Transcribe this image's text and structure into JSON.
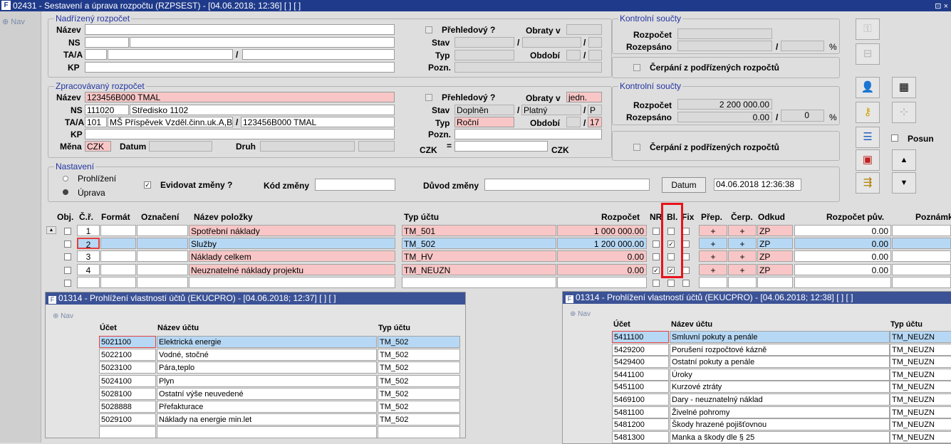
{
  "window": {
    "title": "02431 - Sestavení a úprava rozpočtu (RZPSEST) - [04.06.2018; 12:36] [ ] [ ]",
    "nav": "Nav",
    "window_btn": "⊡ ×"
  },
  "nadrizeny": {
    "legend": "Nadřízený rozpočet",
    "nazev_lbl": "Název",
    "ns_lbl": "NS",
    "taa_lbl": "TA/A",
    "kp_lbl": "KP",
    "prehledovy_lbl": "Přehledový ?",
    "obraty_lbl": "Obraty v",
    "stav_lbl": "Stav",
    "typ_lbl": "Typ",
    "obdobi_lbl": "Období",
    "pozn_lbl": "Pozn.",
    "slash": "/"
  },
  "kontrolni1": {
    "legend": "Kontrolní součty",
    "rozpocet_lbl": "Rozpočet",
    "rozepsano_lbl": "Rozepsáno",
    "pct": "%",
    "slash": "/",
    "cerpani_lbl": "Čerpání z podřízených rozpočtů"
  },
  "zpracovavany": {
    "legend": "Zpracovávaný rozpočet",
    "nazev_lbl": "Název",
    "nazev": "123456B000 TMAL",
    "ns_lbl": "NS",
    "ns_code": "111020",
    "ns_name": "Středisko 1102",
    "taa_lbl": "TA/A",
    "taa_code": "101",
    "taa_name": "MŠ Příspěvek Vzděl.činn.uk.A,B",
    "taa_slash": "/",
    "taa_value": "123456B000 TMAL",
    "kp_lbl": "KP",
    "mena_lbl": "Měna",
    "mena": "CZK",
    "datum_lbl": "Datum",
    "druh_lbl": "Druh",
    "prehledovy_lbl": "Přehledový ?",
    "obraty_lbl": "Obraty v",
    "obraty": "jedn.",
    "stav_lbl": "Stav",
    "stav": "Doplněn",
    "stav_slash": "/",
    "stav2": "Platný",
    "stav_slash2": "/",
    "stav3": "P",
    "typ_lbl": "Typ",
    "typ": "Roční",
    "obdobi_lbl": "Období",
    "obdobi_slash": "/",
    "obdobi": "17",
    "pozn_lbl": "Pozn.",
    "czk1": "CZK",
    "eq": "=",
    "czk2": "CZK"
  },
  "kontrolni2": {
    "legend": "Kontrolní součty",
    "rozpocet_lbl": "Rozpočet",
    "rozpocet": "2 200 000.00",
    "rozepsano_lbl": "Rozepsáno",
    "rozepsano": "0.00",
    "slash": "/",
    "pct_val": "0",
    "pct": "%",
    "cerpani_lbl": "Čerpání z podřízených rozpočtů"
  },
  "nastaveni": {
    "legend": "Nastavení",
    "prohlizeni": "Prohlížení",
    "uprava": "Úprava",
    "evidovat": "Evidovat změny ?",
    "kod_lbl": "Kód změny",
    "duvod_lbl": "Důvod změny",
    "datum_btn": "Datum",
    "datum_value": "04.06.2018 12:36:38"
  },
  "toolbar": {
    "posun": "Posun",
    "up": "▲",
    "down": "▼"
  },
  "grid": {
    "headers": {
      "obj": "Obj.",
      "cr": "Č.ř.",
      "format": "Formát",
      "oznaceni": "Označení",
      "nazev": "Název položky",
      "typ": "Typ účtu",
      "rozpocet": "Rozpočet",
      "nr": "NR",
      "bl": "Bl.",
      "fix": "Fix",
      "prep": "Přep.",
      "cerp": "Čerp.",
      "odkud": "Odkud",
      "puv": "Rozpočet pův.",
      "pozn": "Poznámk"
    },
    "rows": [
      {
        "cr": "1",
        "nazev": "Spotřební náklady",
        "typ": "TM_501",
        "rozpocet": "1 000 000.00",
        "nr": "",
        "bl": "",
        "prep": "+",
        "cerp": "+",
        "odkud": "ZP",
        "puv": "0.00"
      },
      {
        "cr": "2",
        "nazev": "Služby",
        "typ": "TM_502",
        "rozpocet": "1 200 000.00",
        "nr": "",
        "bl": "✓",
        "prep": "+",
        "cerp": "+",
        "odkud": "ZP",
        "puv": "0.00"
      },
      {
        "cr": "3",
        "nazev": "Náklady celkem",
        "typ": "TM_HV",
        "rozpocet": "0.00",
        "nr": "",
        "bl": "",
        "prep": "+",
        "cerp": "+",
        "odkud": "ZP",
        "puv": "0.00"
      },
      {
        "cr": "4",
        "nazev": "Neuznatelné náklady projektu",
        "typ": "TM_NEUZN",
        "rozpocet": "0.00",
        "nr": "✓",
        "bl": "✓",
        "prep": "+",
        "cerp": "+",
        "odkud": "ZP",
        "puv": "0.00"
      }
    ]
  },
  "sub1": {
    "title": "01314 - Prohlížení vlastností účtů (EKUCPRO) - [04.06.2018; 12:37] [ ] [ ]",
    "nav": "Nav",
    "h_ucet": "Účet",
    "h_nazev": "Název účtu",
    "h_typ": "Typ účtu",
    "rows": [
      {
        "ucet": "5021100",
        "nazev": "Elektrická energie",
        "typ": "TM_502"
      },
      {
        "ucet": "5022100",
        "nazev": "Vodné, stočné",
        "typ": "TM_502"
      },
      {
        "ucet": "5023100",
        "nazev": "Pára,teplo",
        "typ": "TM_502"
      },
      {
        "ucet": "5024100",
        "nazev": "Plyn",
        "typ": "TM_502"
      },
      {
        "ucet": "5028100",
        "nazev": "Ostatní výše neuvedené",
        "typ": "TM_502"
      },
      {
        "ucet": "5028888",
        "nazev": "Přefakturace",
        "typ": "TM_502"
      },
      {
        "ucet": "5029100",
        "nazev": "Náklady na energie min.let",
        "typ": "TM_502"
      }
    ]
  },
  "sub2": {
    "title": "01314 - Prohlížení vlastností účtů (EKUCPRO) - [04.06.2018; 12:38] [ ] [ ]",
    "nav": "Nav",
    "h_ucet": "Účet",
    "h_nazev": "Název účtu",
    "h_typ": "Typ účtu",
    "rows": [
      {
        "ucet": "5411100",
        "nazev": "Smluvní pokuty a penále",
        "typ": "TM_NEUZN"
      },
      {
        "ucet": "5429200",
        "nazev": "Porušení rozpočtové kázně",
        "typ": "TM_NEUZN"
      },
      {
        "ucet": "5429400",
        "nazev": "Ostatní pokuty a penále",
        "typ": "TM_NEUZN"
      },
      {
        "ucet": "5441100",
        "nazev": "Úroky",
        "typ": "TM_NEUZN"
      },
      {
        "ucet": "5451100",
        "nazev": "Kurzové ztráty",
        "typ": "TM_NEUZN"
      },
      {
        "ucet": "5469100",
        "nazev": "Dary - neuznatelný náklad",
        "typ": "TM_NEUZN"
      },
      {
        "ucet": "5481100",
        "nazev": "Živelné pohromy",
        "typ": "TM_NEUZN"
      },
      {
        "ucet": "5481200",
        "nazev": "Škody hrazené pojišťovnou",
        "typ": "TM_NEUZN"
      },
      {
        "ucet": "5481300",
        "nazev": "Manka a škody dle § 25",
        "typ": "TM_NEUZN"
      }
    ]
  }
}
